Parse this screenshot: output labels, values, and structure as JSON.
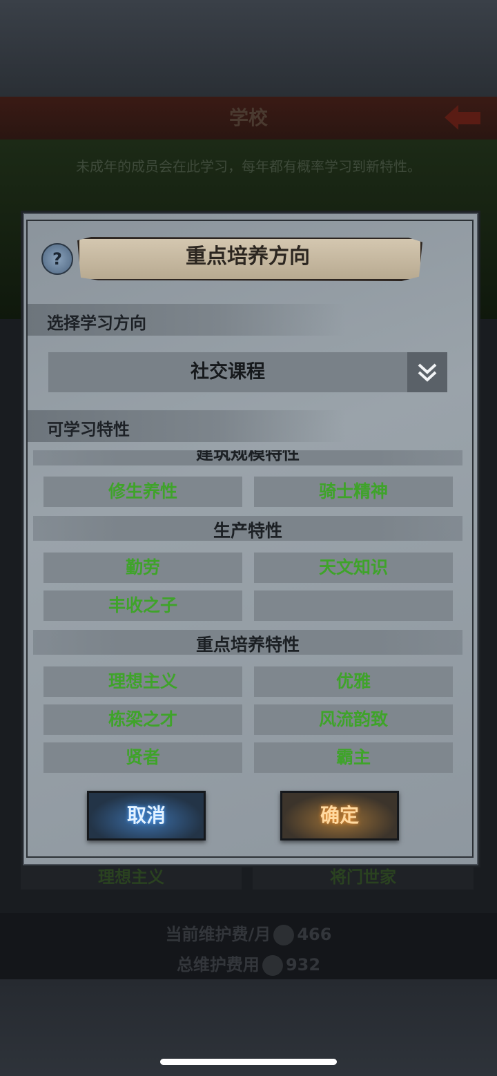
{
  "background": {
    "title": "学校",
    "description": "未成年的成员会在此学习，每年都有概率学习到新特性。",
    "list_items": [
      "理想主义",
      "将门世家"
    ],
    "footer": {
      "maintenance_label": "当前维护费/月",
      "maintenance_value": "466",
      "total_label": "总维护费用",
      "total_value": "932"
    }
  },
  "dialog": {
    "title": "重点培养方向",
    "select_label": "选择学习方向",
    "select_value": "社交课程",
    "traits_label": "可学习特性",
    "categories": [
      {
        "name": "建筑规模特性",
        "traits": [
          "修生养性",
          "骑士精神"
        ]
      },
      {
        "name": "生产特性",
        "traits": [
          "勤劳",
          "天文知识",
          "丰收之子",
          ""
        ]
      },
      {
        "name": "重点培养特性",
        "traits": [
          "理想主义",
          "优雅",
          "栋梁之才",
          "风流韵致",
          "贤者",
          "霸主"
        ]
      }
    ],
    "cancel_label": "取消",
    "confirm_label": "确定"
  },
  "colors": {
    "trait_text": "#3fa32a",
    "cancel_glow": "#3b6ea8",
    "confirm_glow": "#9c7036"
  },
  "icons": {
    "help": "question-mark-icon",
    "dropdown": "double-chevron-down-icon",
    "back": "back-arrow-icon",
    "coin": "coin-icon"
  }
}
